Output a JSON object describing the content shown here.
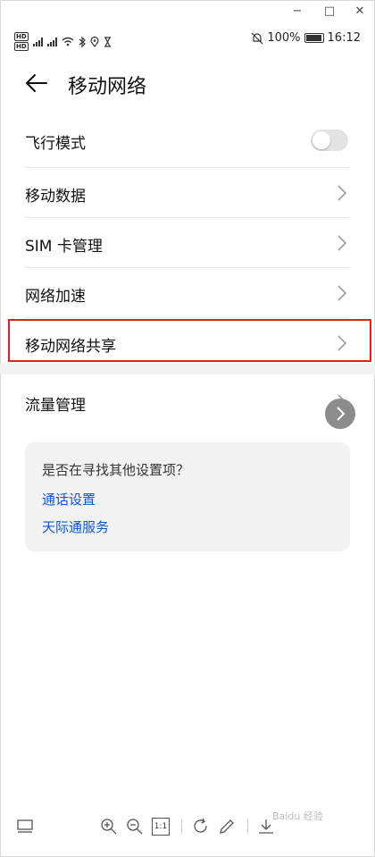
{
  "window": {
    "minimize_glyph": "−",
    "maximize_glyph": "□",
    "close_glyph": "✕"
  },
  "status_bar": {
    "left_icons": [
      "hd-icon",
      "signal-icon",
      "wifi-icon",
      "bluetooth-icon",
      "location-icon",
      "hourglass-icon"
    ],
    "right_icons": [
      "bell-off-icon",
      "battery-icon"
    ],
    "battery": "100%",
    "time": "16:12"
  },
  "header": {
    "title": "移动网络"
  },
  "list": {
    "airplane": "飞行模式",
    "airplane_enabled": false,
    "mobile_data": "移动数据",
    "sim": "SIM 卡管理",
    "acceleration": "网络加速",
    "hotspot": "移动网络共享",
    "data_usage": "流量管理"
  },
  "card": {
    "question": "是否在寻找其他设置项？",
    "link1": "通话设置",
    "link2": "天际通服务"
  },
  "toolbar": {
    "icons": [
      "layout-icon",
      "zoom-in-icon",
      "zoom-out-icon",
      "actual-size-icon",
      "rotate-icon",
      "edit-icon",
      "download-icon"
    ],
    "actual_size": "1:1",
    "watermark": "Baidu 经验"
  },
  "colors": {
    "accent": "#0a59d1",
    "highlight": "#e02020"
  }
}
